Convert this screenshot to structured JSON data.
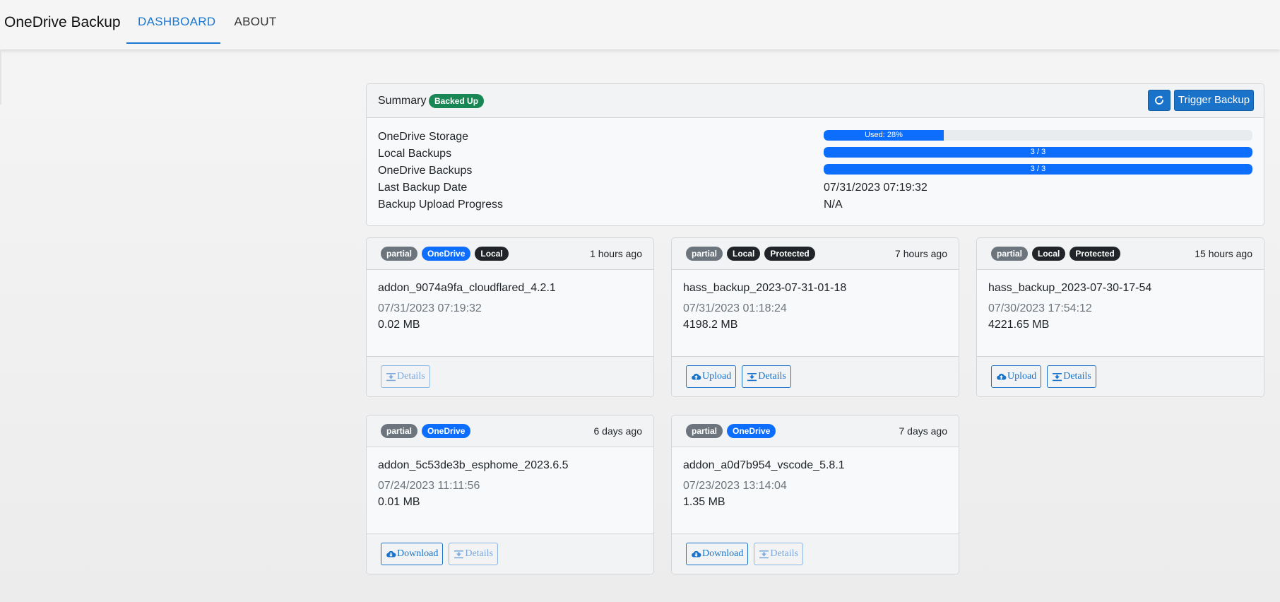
{
  "app": {
    "title": "OneDrive Backup",
    "tabs": [
      {
        "label": "DASHBOARD",
        "active": true
      },
      {
        "label": "ABOUT",
        "active": false
      }
    ]
  },
  "summary": {
    "title": "Summary",
    "status_badge": "Backed Up",
    "refresh_icon": "refresh-icon",
    "trigger_label": "Trigger Backup",
    "rows": [
      {
        "label": "OneDrive Storage",
        "bar_label": "Used: 28%",
        "percent": 28
      },
      {
        "label": "Local Backups",
        "bar_label": "3 / 3",
        "percent": 100
      },
      {
        "label": "OneDrive Backups",
        "bar_label": "3 / 3",
        "percent": 100
      },
      {
        "label": "Last Backup Date",
        "value": "07/31/2023 07:19:32"
      },
      {
        "label": "Backup Upload Progress",
        "value": "N/A"
      }
    ]
  },
  "backups": [
    {
      "badges": [
        "partial",
        "OneDrive",
        "Local"
      ],
      "time_ago": "1 hours ago",
      "name": "addon_9074a9fa_cloudflared_4.2.1",
      "date": "07/31/2023 07:19:32",
      "size": "0.02 MB",
      "actions": [
        {
          "label": "Details",
          "icon": "details-icon",
          "disabled": true
        }
      ]
    },
    {
      "badges": [
        "partial",
        "Local",
        "Protected"
      ],
      "time_ago": "7 hours ago",
      "name": "hass_backup_2023-07-31-01-18",
      "date": "07/31/2023 01:18:24",
      "size": "4198.2 MB",
      "actions": [
        {
          "label": "Upload",
          "icon": "cloud-upload-icon",
          "disabled": false
        },
        {
          "label": "Details",
          "icon": "details-icon",
          "disabled": false
        }
      ]
    },
    {
      "badges": [
        "partial",
        "Local",
        "Protected"
      ],
      "time_ago": "15 hours ago",
      "name": "hass_backup_2023-07-30-17-54",
      "date": "07/30/2023 17:54:12",
      "size": "4221.65 MB",
      "actions": [
        {
          "label": "Upload",
          "icon": "cloud-upload-icon",
          "disabled": false
        },
        {
          "label": "Details",
          "icon": "details-icon",
          "disabled": false
        }
      ]
    },
    {
      "badges": [
        "partial",
        "OneDrive"
      ],
      "time_ago": "6 days ago",
      "name": "addon_5c53de3b_esphome_2023.6.5",
      "date": "07/24/2023 11:11:56",
      "size": "0.01 MB",
      "actions": [
        {
          "label": "Download",
          "icon": "cloud-download-icon",
          "disabled": false
        },
        {
          "label": "Details",
          "icon": "details-icon",
          "disabled": true
        }
      ]
    },
    {
      "badges": [
        "partial",
        "OneDrive"
      ],
      "time_ago": "7 days ago",
      "name": "addon_a0d7b954_vscode_5.8.1",
      "date": "07/23/2023 13:14:04",
      "size": "1.35 MB",
      "actions": [
        {
          "label": "Download",
          "icon": "cloud-download-icon",
          "disabled": false
        },
        {
          "label": "Details",
          "icon": "details-icon",
          "disabled": true
        }
      ]
    }
  ],
  "colors": {
    "accent": "#1976d2",
    "primary_button": "#1a73c9",
    "progress": "#0d6efd",
    "badge_success": "#198754",
    "badge_partial": "#6c757d",
    "badge_onedrive": "#0d6efd",
    "badge_dark": "#212529"
  }
}
